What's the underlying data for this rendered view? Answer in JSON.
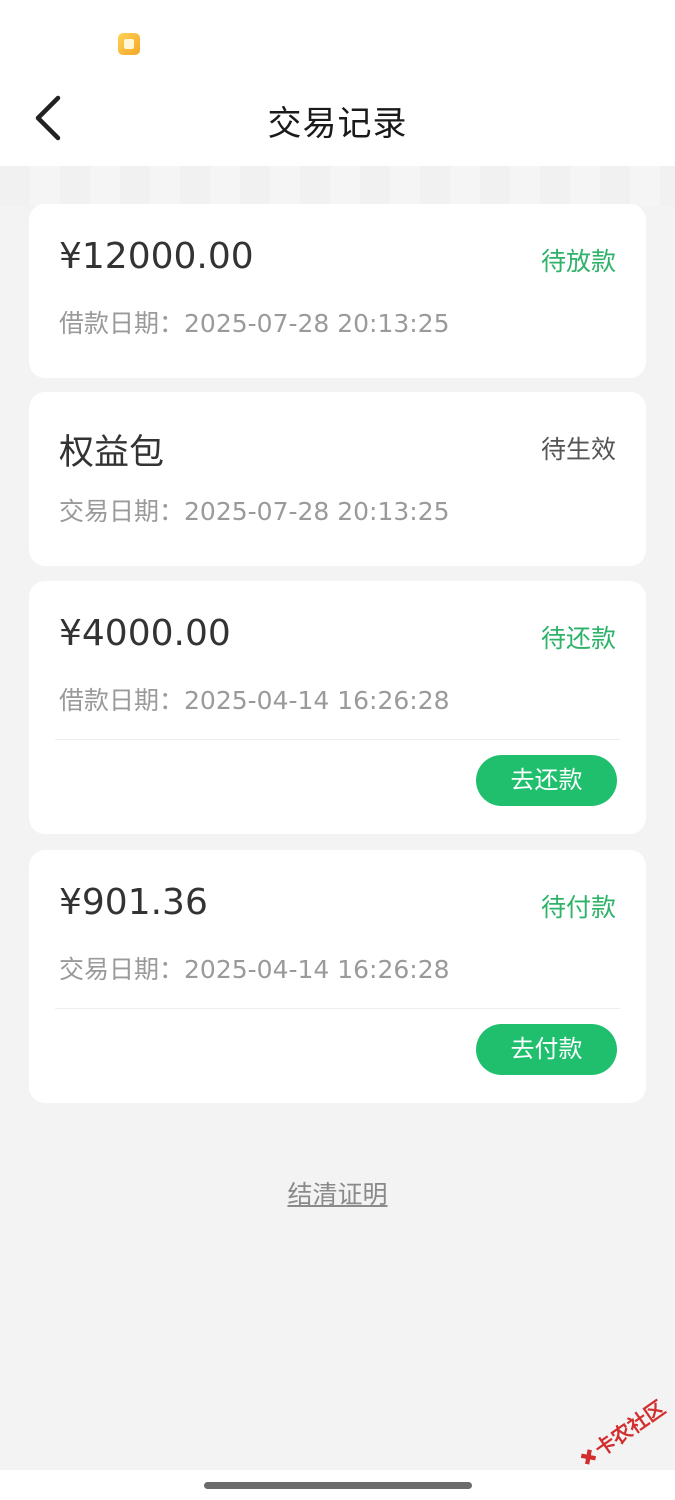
{
  "nav": {
    "title": "交易记录"
  },
  "records": [
    {
      "amount": "¥12000.00",
      "status": "待放款",
      "date_label": "借款日期：",
      "date": "2025-07-28 20:13:25"
    },
    {
      "amount": "权益包",
      "status": "待生效",
      "date_label": "交易日期：",
      "date": "2025-07-28 20:13:25"
    },
    {
      "amount": "¥4000.00",
      "status": "待还款",
      "date_label": "借款日期：",
      "date": "2025-04-14 16:26:28",
      "action": "去还款"
    },
    {
      "amount": "¥901.36",
      "status": "待付款",
      "date_label": "交易日期：",
      "date": "2025-04-14 16:26:28",
      "action": "去付款"
    }
  ],
  "footer": {
    "settlement_link": "结清证明"
  },
  "watermark": {
    "text": "卡农社区"
  },
  "colors": {
    "accent_green": "#1fbf6e",
    "status_green": "#2fb26a",
    "background": "#f3f3f3"
  }
}
